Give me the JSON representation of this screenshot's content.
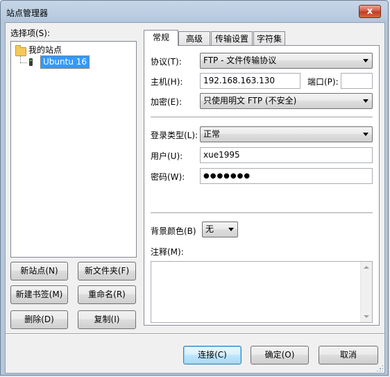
{
  "window": {
    "title": "站点管理器",
    "close_glyph": "x"
  },
  "tree": {
    "label": "选择项(S):",
    "root": {
      "label": "我的站点",
      "icon": "folder-icon"
    },
    "children": [
      {
        "label": "Ubuntu 16",
        "icon": "server-icon",
        "selected": true
      }
    ]
  },
  "left_buttons": {
    "new_site": "新站点(N)",
    "new_folder": "新文件夹(F)",
    "new_bookmark": "新建书签(M)",
    "rename": "重命名(R)",
    "delete": "删除(D)",
    "copy": "复制(I)"
  },
  "tabs": [
    {
      "label": "常规",
      "active": true
    },
    {
      "label": "高级",
      "active": false
    },
    {
      "label": "传输设置",
      "active": false
    },
    {
      "label": "字符集",
      "active": false
    }
  ],
  "general": {
    "protocol_label": "协议(T):",
    "protocol_value": "FTP - 文件传输协议",
    "host_label": "主机(H):",
    "host_value": "192.168.163.130",
    "port_label": "端口(P):",
    "port_value": "",
    "encryption_label": "加密(E):",
    "encryption_value": "只使用明文 FTP (不安全)",
    "logon_type_label": "登录类型(L):",
    "logon_type_value": "正常",
    "user_label": "用户(U):",
    "user_value": "xue1995",
    "password_label": "密码(W):",
    "password_value": "●●●●●●●",
    "bg_color_label": "背景颜色(B)",
    "bg_color_value": "无",
    "comments_label": "注释(M):",
    "comments_value": ""
  },
  "bottom_buttons": {
    "connect": "连接(C)",
    "ok": "确定(O)",
    "cancel": "取消"
  },
  "colors": {
    "selection": "#3399ff",
    "default_button_border": "#3c7fb1",
    "close_button": "#c7452a"
  }
}
